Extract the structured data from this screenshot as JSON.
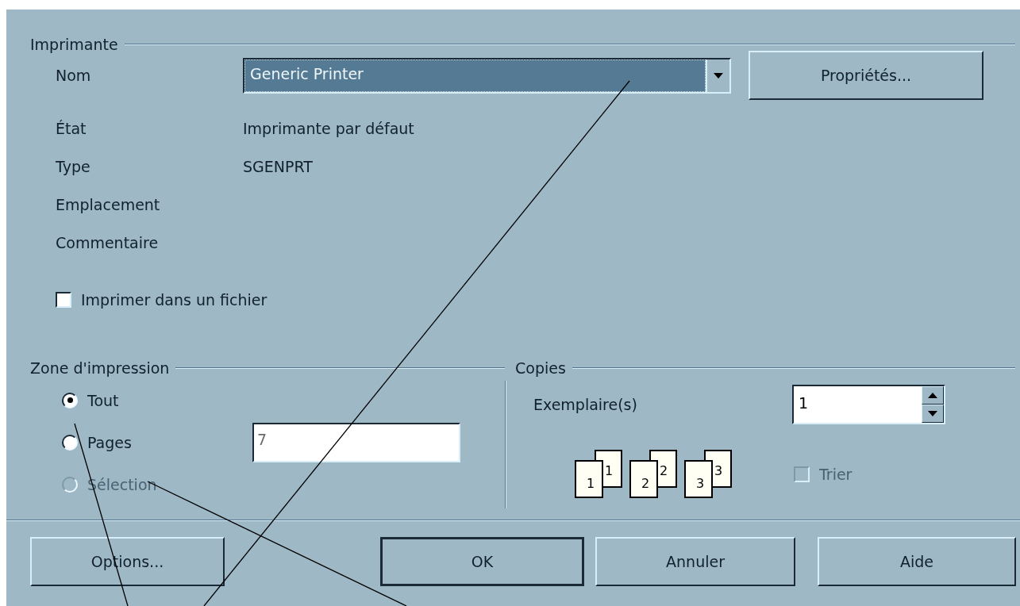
{
  "printer": {
    "title": "Imprimante",
    "name_label": {
      "text": "Nom"
    },
    "name_value": "Generic Printer",
    "properties_button": {
      "text": "Propriétés..."
    },
    "info": [
      {
        "label": "État",
        "value": "Imprimante par défaut"
      },
      {
        "label": "Type",
        "value": "SGENPRT"
      },
      {
        "label": "Emplacement"
      },
      {
        "label": "Commentaire"
      }
    ],
    "print_to_file": {
      "label": "Imprimer dans un fichier",
      "checked": false
    }
  },
  "print_range": {
    "title": "Zone d'impression",
    "options": [
      {
        "label": "Tout",
        "selected": true,
        "disabled": false
      },
      {
        "label": "Pages",
        "selected": false,
        "disabled": false
      },
      {
        "label": "Sélection",
        "selected": false,
        "disabled": true
      }
    ],
    "pages_field": {
      "value": "7",
      "disabled": true
    }
  },
  "copies": {
    "title": "Copies",
    "count_label": {
      "text": "Exemplaire(s)"
    },
    "count_value": "1",
    "collate_pages": [
      {
        "back": "1",
        "front": "1"
      },
      {
        "back": "2",
        "front": "2"
      },
      {
        "back": "3",
        "front": "3"
      }
    ],
    "collate": {
      "label": "Trier",
      "checked": false,
      "disabled": true
    }
  },
  "buttons": [
    {
      "text": "Options...",
      "default": false
    },
    {
      "text": "OK",
      "default": true
    },
    {
      "text": "Annuler",
      "default": false
    },
    {
      "text": "Aide",
      "default": false
    }
  ]
}
